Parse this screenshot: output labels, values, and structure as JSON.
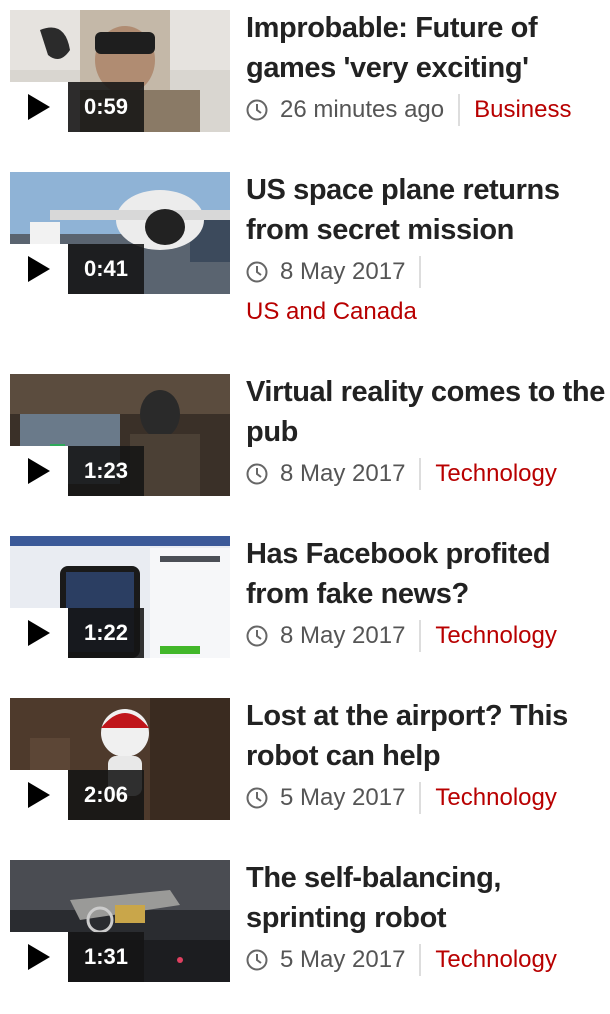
{
  "items": [
    {
      "title": "Improbable: Future of games 'very exciting'",
      "duration": "0:59",
      "time": "26 minutes ago",
      "topic": "Business",
      "thumb": "person-vr"
    },
    {
      "title": "US space plane returns from secret mission",
      "duration": "0:41",
      "time": "8 May 2017",
      "topic": "US and Canada",
      "thumb": "space-plane"
    },
    {
      "title": "Virtual reality comes to the pub",
      "duration": "1:23",
      "time": "8 May 2017",
      "topic": "Technology",
      "thumb": "pub-vr"
    },
    {
      "title": "Has Facebook profited from fake news?",
      "duration": "1:22",
      "time": "8 May 2017",
      "topic": "Technology",
      "thumb": "facebook"
    },
    {
      "title": "Lost at the airport? This robot can help",
      "duration": "2:06",
      "time": "5 May 2017",
      "topic": "Technology",
      "thumb": "airport-robot"
    },
    {
      "title": "The self-balancing, sprinting robot",
      "duration": "1:31",
      "time": "5 May 2017",
      "topic": "Technology",
      "thumb": "sprint-robot"
    }
  ],
  "colors": {
    "topic": "#b80000",
    "title": "#222222",
    "meta": "#555555"
  }
}
